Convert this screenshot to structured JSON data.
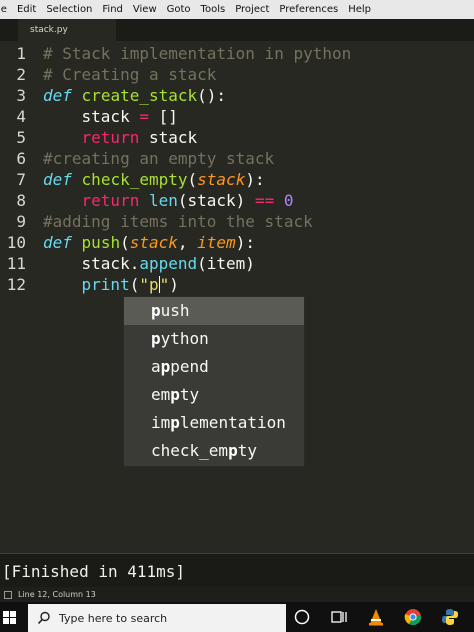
{
  "menubar": [
    "le",
    "Edit",
    "Selection",
    "Find",
    "View",
    "Goto",
    "Tools",
    "Project",
    "Preferences",
    "Help"
  ],
  "tab": {
    "filename": "stack.py"
  },
  "editor": {
    "line_numbers": [
      "1",
      "2",
      "3",
      "4",
      "5",
      "6",
      "7",
      "8",
      "9",
      "10",
      "11",
      "12"
    ],
    "lines": {
      "l1": "# Stack implementation in python",
      "l2": "# Creating a stack",
      "l3_kw": "def",
      "l3_fn": "create_stack",
      "l3_rest": "():",
      "l4_a": "    stack ",
      "l4_op": "=",
      "l4_b": " []",
      "l5_indent": "    ",
      "l5_ret": "return",
      "l5_b": " stack",
      "l6": "#creating an empty stack",
      "l7_kw": "def",
      "l7_fn": "check_empty",
      "l7_open": "(",
      "l7_param": "stack",
      "l7_close": "):",
      "l8_indent": "    ",
      "l8_ret": "return",
      "l8_sp": " ",
      "l8_len": "len",
      "l8_mid": "(stack) ",
      "l8_op": "==",
      "l8_sp2": " ",
      "l8_num": "0",
      "l9": "#adding items into the stack",
      "l10_kw": "def",
      "l10_fn": "push",
      "l10_open": "(",
      "l10_p1": "stack",
      "l10_comma": ", ",
      "l10_p2": "item",
      "l10_close": "):",
      "l11_a": "    stack.",
      "l11_fn": "append",
      "l11_b": "(item)",
      "l12_indent": "    ",
      "l12_fn": "print",
      "l12_open": "(",
      "l12_str": "\"p",
      "l12_str2": "\"",
      "l12_close": ")"
    },
    "autocomplete": [
      {
        "match": "p",
        "rest": "ush"
      },
      {
        "match": "p",
        "rest": "ython"
      },
      {
        "pre": "a",
        "match": "p",
        "rest": "pend"
      },
      {
        "pre": "em",
        "match": "p",
        "rest": "ty"
      },
      {
        "pre": "im",
        "match": "p",
        "rest": "lementation"
      },
      {
        "pre": "check_em",
        "match": "p",
        "rest": "ty"
      }
    ]
  },
  "output": {
    "text": "[Finished in 411ms]"
  },
  "statusbar": {
    "position": "Line 12, Column 13"
  },
  "taskbar": {
    "search_placeholder": "Type here to search"
  },
  "colors": {
    "background": "#272822",
    "comment": "#75715e",
    "keyword": "#66d9ef",
    "function": "#a6e22e",
    "return": "#f92672",
    "param": "#fd971f",
    "number": "#ae81ff",
    "string": "#e6db74"
  }
}
